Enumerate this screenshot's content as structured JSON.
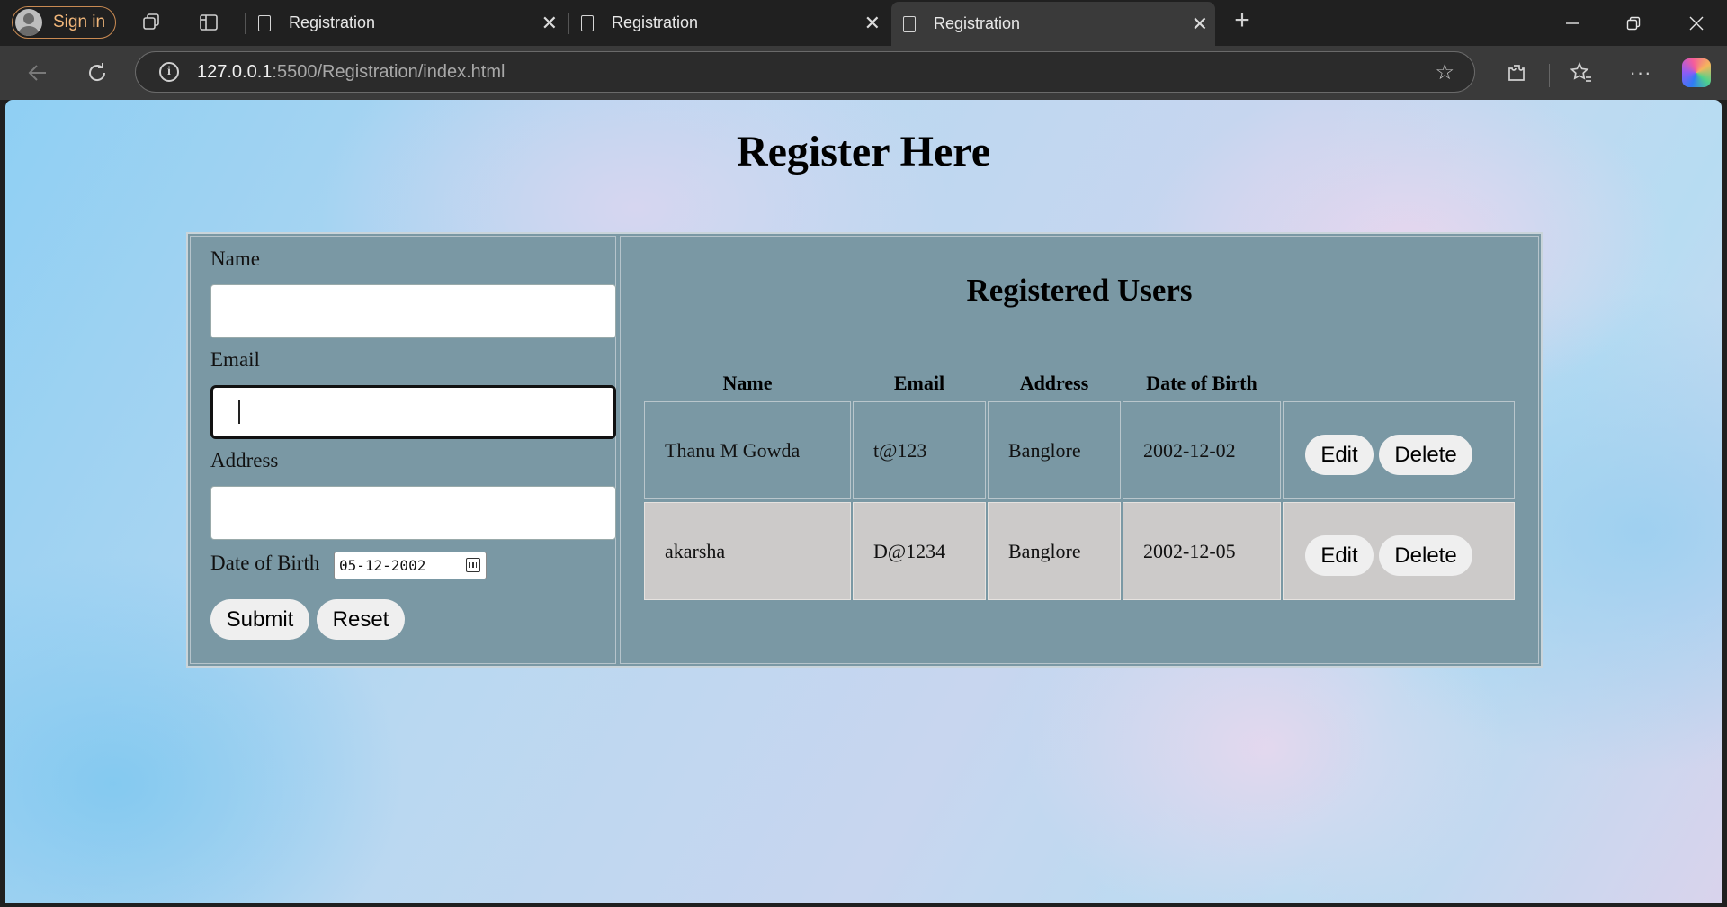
{
  "browser": {
    "signin_label": "Sign in",
    "tabs": [
      {
        "title": "Registration"
      },
      {
        "title": "Registration"
      },
      {
        "title": "Registration"
      }
    ],
    "active_tab": 2,
    "new_tab_symbol": "+",
    "url_host": "127.0.0.1",
    "url_rest": ":5500/Registration/index.html",
    "icons": [
      "workspaces-icon",
      "tab-actions-icon",
      "back-icon",
      "refresh-icon",
      "info-icon",
      "favorite-star-icon",
      "extensions-icon",
      "favorites-icon",
      "more-icon",
      "copilot-icon",
      "minimize-icon",
      "restore-icon",
      "close-icon"
    ]
  },
  "page": {
    "title": "Register Here",
    "form": {
      "name_label": "Name",
      "name_value": "",
      "email_label": "Email",
      "email_value": "",
      "address_label": "Address",
      "address_value": "",
      "dob_label": "Date of Birth",
      "dob_value": "05-12-2002",
      "submit_label": "Submit",
      "reset_label": "Reset"
    },
    "users": {
      "title": "Registered Users",
      "headers": [
        "Name",
        "Email",
        "Address",
        "Date of Birth"
      ],
      "rows": [
        {
          "name": "Thanu M Gowda",
          "email": "t@123",
          "address": "Banglore",
          "dob": "2002-12-02"
        },
        {
          "name": "akarsha",
          "email": "D@1234",
          "address": "Banglore",
          "dob": "2002-12-05"
        }
      ],
      "edit_label": "Edit",
      "delete_label": "Delete"
    }
  }
}
